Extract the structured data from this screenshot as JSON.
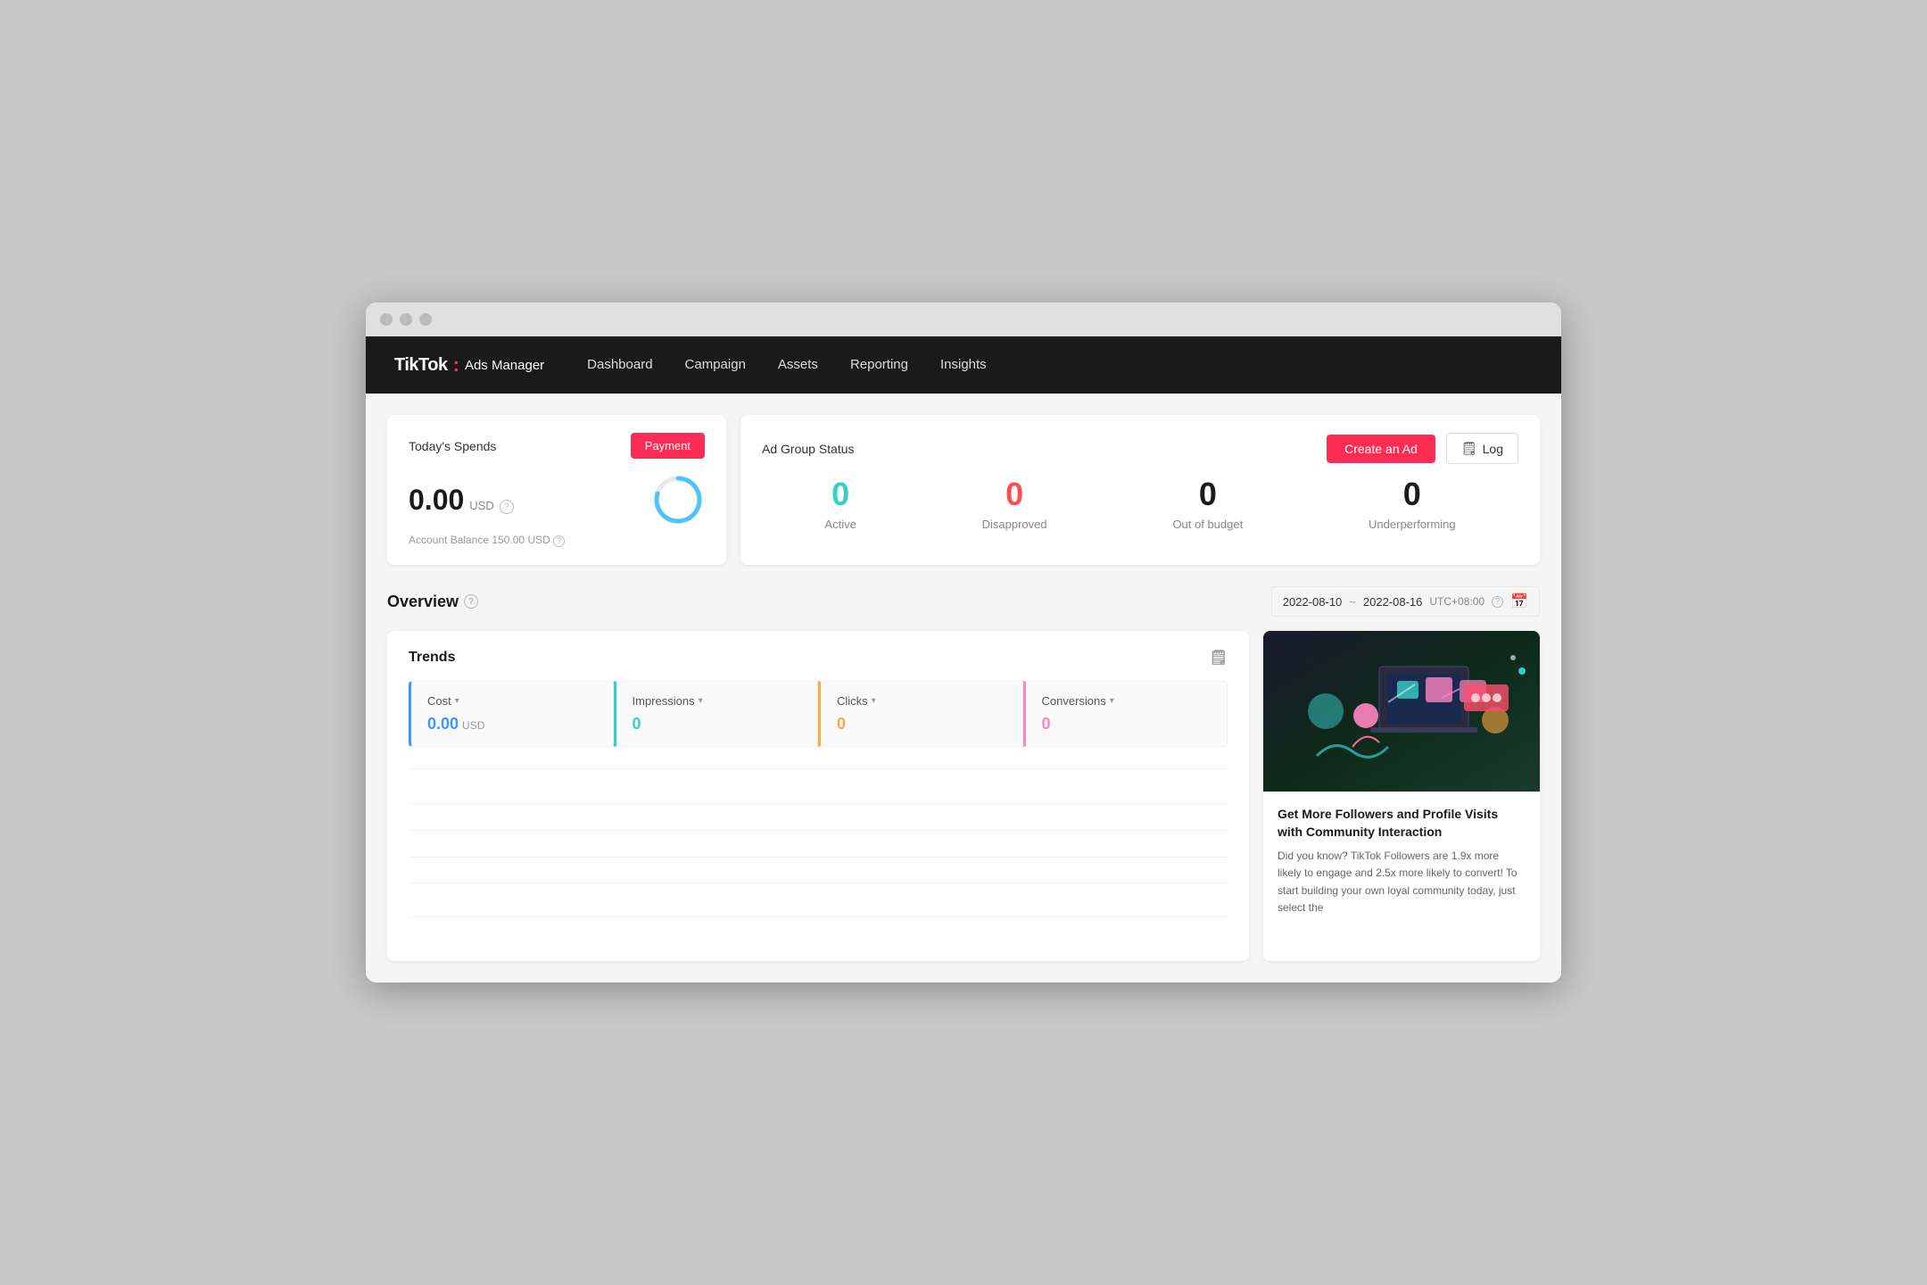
{
  "browser": {
    "dots": [
      "dot1",
      "dot2",
      "dot3"
    ]
  },
  "navbar": {
    "logo": "TikTok",
    "logo_dot": ":",
    "logo_subtitle": "Ads Manager",
    "links": [
      "Dashboard",
      "Campaign",
      "Assets",
      "Reporting",
      "Insights"
    ]
  },
  "spending_panel": {
    "title": "Today's Spends",
    "payment_btn": "Payment",
    "amount": "0.00",
    "currency": "USD",
    "balance_label": "Account Balance",
    "balance_value": "150.00",
    "balance_currency": "USD"
  },
  "ad_status_panel": {
    "title": "Ad Group Status",
    "create_btn": "Create an Ad",
    "log_btn": "Log",
    "statuses": [
      {
        "number": "0",
        "label": "Active",
        "color": "active"
      },
      {
        "number": "0",
        "label": "Disapproved",
        "color": "disapproved"
      },
      {
        "number": "0",
        "label": "Out of budget",
        "color": "normal"
      },
      {
        "number": "0",
        "label": "Underperforming",
        "color": "normal"
      }
    ]
  },
  "overview": {
    "title": "Overview",
    "help": "?",
    "date_start": "2022-08-10",
    "date_sep": "~",
    "date_end": "2022-08-16",
    "timezone": "UTC+08:00",
    "trends_title": "Trends",
    "export_icon": "📄",
    "metrics": [
      {
        "label": "Cost",
        "value": "0.00",
        "unit": "USD",
        "color": "blue"
      },
      {
        "label": "Impressions",
        "value": "0",
        "unit": "",
        "color": "teal"
      },
      {
        "label": "Clicks",
        "value": "0",
        "unit": "",
        "color": "orange"
      },
      {
        "label": "Conversions",
        "value": "0",
        "unit": "",
        "color": "pink"
      }
    ]
  },
  "side_card": {
    "title": "Get More Followers and Profile Visits with Community Interaction",
    "text": "Did you know? TikTok Followers are 1.9x more likely to engage and 2.5x more likely to convert! To start building your own loyal community today, just select the"
  }
}
